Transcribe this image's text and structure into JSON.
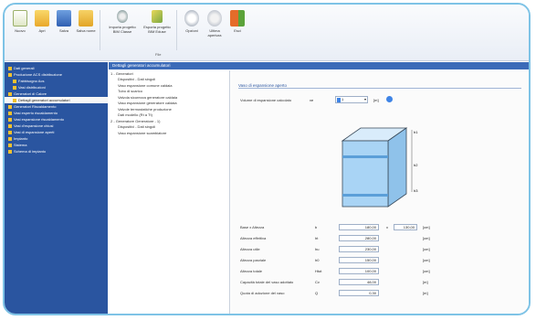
{
  "ribbon": {
    "buttons": [
      {
        "label": "Nuovo",
        "icon": "new-file-icon"
      },
      {
        "label": "Apri",
        "icon": "folder-open-icon"
      },
      {
        "label": "Salva",
        "icon": "save-icon"
      },
      {
        "label": "Salva nome",
        "icon": "save-as-icon"
      },
      {
        "label": "Importa progetto BIM Classe",
        "icon": "import-bim-icon"
      },
      {
        "label": "Esporta progetto BIM Eduse",
        "icon": "export-bim-icon"
      },
      {
        "label": "Opzioni",
        "icon": "options-icon"
      },
      {
        "label": "Ultima apertura",
        "icon": "recent-icon"
      },
      {
        "label": "Esci",
        "icon": "exit-icon"
      }
    ],
    "group_label": "File"
  },
  "sidebar": {
    "items": [
      {
        "label": "Dati generali",
        "level": 0
      },
      {
        "label": "Produzione ACS distribuzione",
        "level": 0
      },
      {
        "label": "Fabbisogno Acs",
        "level": 1
      },
      {
        "label": "Vasi distribuzioni",
        "level": 1
      },
      {
        "label": "Generatori di Calore",
        "level": 0
      },
      {
        "label": "Dettagli generatori accumulatori",
        "level": 1,
        "selected": true
      },
      {
        "label": "Generatori Riscaldamento",
        "level": 0
      },
      {
        "label": "Vasi esperto riscaldamento",
        "level": 0
      },
      {
        "label": "Vasi espansione riscaldamento",
        "level": 0
      },
      {
        "label": "Vasi d'espansione chiusi",
        "level": 0
      },
      {
        "label": "Vasi di espansione aperti",
        "level": 0
      },
      {
        "label": "Impianto",
        "level": 0
      },
      {
        "label": "Sistema",
        "level": 0
      },
      {
        "label": "Schema di impianto",
        "level": 0
      }
    ]
  },
  "panel": {
    "header": "Dettagli generatori accumulatori"
  },
  "tree": {
    "items": [
      {
        "label": "1 - Generatori",
        "level": 0
      },
      {
        "label": "Dispositivi - Dati singoli",
        "level": 1
      },
      {
        "label": "Vaso espansione comune caldaia",
        "level": 1
      },
      {
        "label": "Tubo di scarico",
        "level": 1
      },
      {
        "label": "Valvola sicurezza generatore caldaia",
        "level": 1
      },
      {
        "label": "Vaso espansione generatore caldaia",
        "level": 1
      },
      {
        "label": "Valvole termostatiche produzione",
        "level": 1
      },
      {
        "label": "Dati modello (Rt a Tt)",
        "level": 1
      },
      {
        "label": "2 - Generatore Generatore - 1)",
        "level": 0
      },
      {
        "label": "Dispositivi - Dati singoli",
        "level": 1
      },
      {
        "label": "Vaso espansione scambiatore",
        "level": 1
      }
    ]
  },
  "form": {
    "title": "Vaso di espansione aperto",
    "volume": {
      "label": "Volume di espansione calcolato",
      "symbol": "ve",
      "value": "1",
      "unit": "[m]"
    },
    "fields": [
      {
        "label": "Base x Altezza",
        "symbol": "b",
        "value": "180,00",
        "value2": "130,00",
        "unit": "[cm]"
      },
      {
        "label": "Altezza effettiva",
        "symbol": "ht",
        "value": "280,00",
        "unit": "[cm]"
      },
      {
        "label": "Altezza utile",
        "symbol": "hu",
        "value": "230,00",
        "unit": "[cm]"
      },
      {
        "label": "Altezza parziale",
        "symbol": "h0",
        "value": "150,00",
        "unit": "[cm]"
      },
      {
        "label": "Altezza totale",
        "symbol": "Htot",
        "value": "100,00",
        "unit": "[cm]"
      },
      {
        "label": "Capacità totale del vaso adottato",
        "symbol": "Cv",
        "value": "48,00",
        "unit": "[m]"
      },
      {
        "label": "Quota di adozione del vaso",
        "symbol": "Q",
        "value": "0,30",
        "unit": "[m]"
      }
    ],
    "diagram_labels": {
      "top": "h1",
      "mid": "h2",
      "bottom": "h3"
    }
  },
  "colors": {
    "sidebar_bg": "#2a55a0",
    "accent": "#3f84e6",
    "frame_border": "#7ec3e6",
    "tank_fill": "#a9d4f5"
  }
}
